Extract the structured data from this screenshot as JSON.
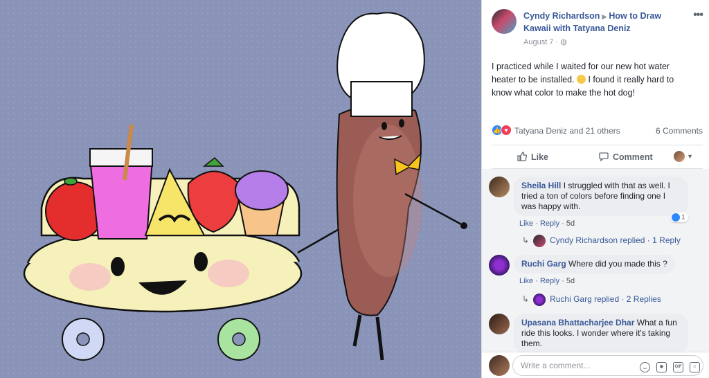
{
  "post": {
    "author": "Cyndy Richardson",
    "group": "How to Draw Kawaii with Tatyana Deniz",
    "date": "August 7",
    "privacy_icon": "globe-icon",
    "text_before_emoji": "I practiced while I waited for our new hot water heater to be installed. ",
    "emoji": "slightly-smiling-face",
    "text_after_emoji": " I found it really hard to know what color to make the hot dog!",
    "reactions": {
      "names": "Tatyana Deniz and 21 others",
      "types": [
        "like",
        "love"
      ]
    },
    "comment_count": "6 Comments"
  },
  "actions": {
    "like": "Like",
    "comment": "Comment"
  },
  "comments": [
    {
      "name": "Sheila Hill",
      "text": "I struggled with that as well. I tried a ton of colors before finding one I was happy with.",
      "like": "Like",
      "reply": "Reply",
      "time": "5d",
      "like_count": "1",
      "reply_summary": {
        "name": "Cyndy Richardson replied",
        "link": "1 Reply"
      }
    },
    {
      "name": "Ruchi Garg",
      "text": "Where did you made this ?",
      "like": "Like",
      "reply": "Reply",
      "time": "5d",
      "reply_summary": {
        "name": "Ruchi Garg replied",
        "link": "2 Replies"
      }
    },
    {
      "name": "Upasana Bhattacharjee Dhar",
      "text": "What a fun ride this looks. I wonder where it's taking them."
    }
  ],
  "composer": {
    "placeholder": "Write a comment..."
  },
  "colors": {
    "link": "#385898",
    "bg": "#8a93b8",
    "like_blue": "#2d88ff",
    "love_red": "#f33e58"
  }
}
